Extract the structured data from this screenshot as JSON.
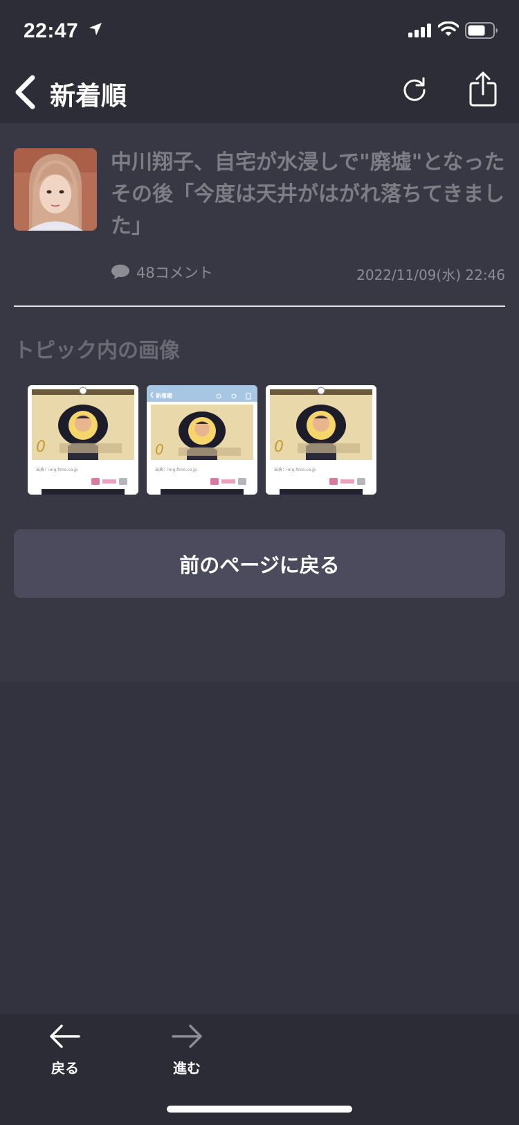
{
  "status_bar": {
    "time": "22:47"
  },
  "nav": {
    "title": "新着順"
  },
  "article": {
    "title": "中川翔子、自宅が水浸しで\"廃墟\"となったその後「今度は天井がはがれ落ちてきました」",
    "comments": "48コメント",
    "date": "2022/11/09(水) 22:46"
  },
  "section": {
    "title": "トピック内の画像"
  },
  "image_cards": [
    {
      "source": "出典：img.fimo.co.jp"
    },
    {
      "header": "新着順",
      "source": "出典：img.fimo.co.jp"
    },
    {
      "source": "出典：img.fimo.co.jp"
    }
  ],
  "back_page_button": "前のページに戻る",
  "toolbar": {
    "back_label": "戻る",
    "forward_label": "進む"
  },
  "colors": {
    "background": "#383845",
    "bar": "#2d2d38",
    "button": "#4c4a5d",
    "accent_pink": "#d87ba1"
  },
  "icons": [
    "location-arrow-icon",
    "signal-icon",
    "wifi-icon",
    "battery-icon",
    "chevron-left-icon",
    "reload-icon",
    "share-icon",
    "comment-icon",
    "arrow-left-icon",
    "arrow-right-icon"
  ]
}
